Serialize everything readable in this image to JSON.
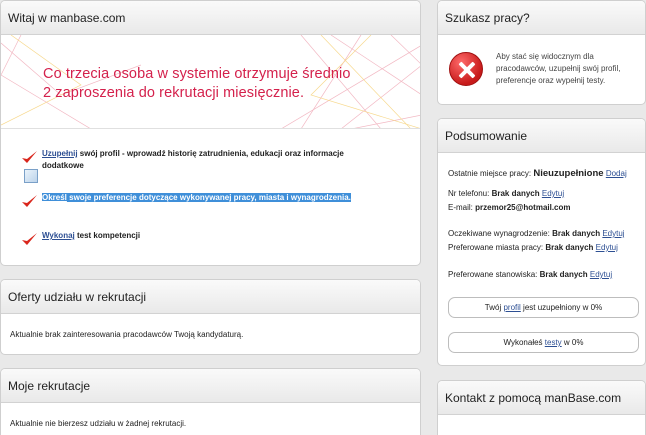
{
  "welcome": {
    "title": "Witaj w manbase.com",
    "banner_line1": "Co trzecia osoba w systemie otrzymuje średnio",
    "banner_line2": "2 zaproszenia do rekrutacji miesięcznie.",
    "step1_link": "Uzupełnij",
    "step1_text": " swój profil - wprowadź historię zatrudnienia, edukacji oraz informacje dodatkowe",
    "step2_link": "Określ",
    "step2_text": " swoje preferencje dotyczące wykonywanej pracy, miasta i wynagrodzenia.",
    "step3_link": "Wykonaj",
    "step3_text": " test kompetencji"
  },
  "offers": {
    "title": "Oferty udziału w rekrutacji",
    "text": "Aktualnie brak zainteresowania pracodawców Twoją kandydaturą."
  },
  "my_recruitments": {
    "title": "Moje rekrutacje",
    "text": "Aktualnie nie bierzesz udziału w żadnej rekrutacji."
  },
  "job_search": {
    "title": "Szukasz pracy?",
    "text": "Aby stać się widocznym dla pracodawców, uzupełnij swój profil, preferencje oraz wypełnij testy."
  },
  "summary": {
    "title": "Podsumowanie",
    "last_job_label": "Ostatnie miejsce pracy:",
    "last_job_value": "Nieuzupełnione",
    "last_job_link": "Dodaj",
    "phone_label": "Nr telefonu:",
    "phone_value": "Brak danych",
    "phone_link": "Edytuj",
    "email_label": "E-mail:",
    "email_value": "przemor25@hotmail.com",
    "salary_label": "Oczekiwane wynagrodzenie:",
    "salary_value": "Brak danych",
    "salary_link": "Edytuj",
    "cities_label": "Preferowane miasta pracy:",
    "cities_value": "Brak danych",
    "cities_link": "Edytuj",
    "positions_label": "Preferowane stanowiska:",
    "positions_value": "Brak danych",
    "positions_link": "Edytuj",
    "profile_pre": "Twój ",
    "profile_link": "profil",
    "profile_post": " jest uzupełniony w 0%",
    "profile_percent": 0,
    "tests_pre": "Wykonałeś ",
    "tests_link": "testy",
    "tests_post": " w 0%",
    "tests_percent": 0
  },
  "contact": {
    "title": "Kontakt z pomocą manBase.com"
  },
  "colors": {
    "accent": "#d4214c",
    "link": "#2d4f93",
    "selection": "#3f8fd9",
    "error": "#c71a1a"
  }
}
